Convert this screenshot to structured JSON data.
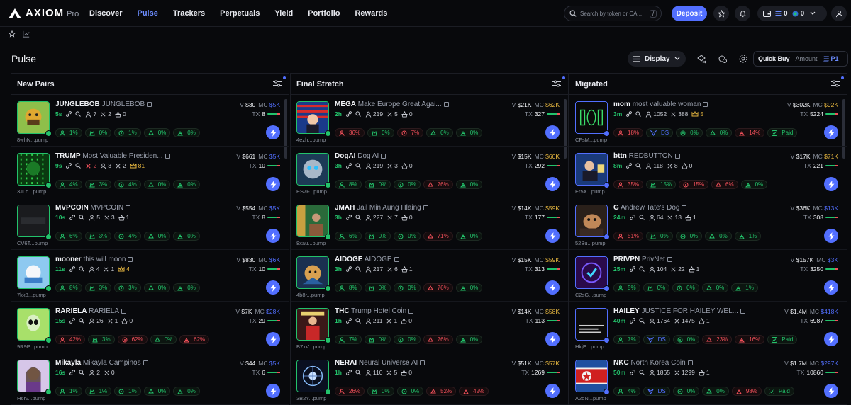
{
  "app": {
    "logo_text": "AXIOM",
    "logo_suffix": "Pro",
    "nav": [
      "Discover",
      "Pulse",
      "Trackers",
      "Perpetuals",
      "Yield",
      "Portfolio",
      "Rewards"
    ],
    "active_nav": "Pulse",
    "search_placeholder": "Search by token or CA...",
    "search_shortcut": "/",
    "deposit_label": "Deposit",
    "wallet_sol_balance": "0",
    "wallet_token_balance": "0",
    "accent": "#526fff",
    "positive": "#23c26b",
    "negative": "#f0505a",
    "gold": "#e8b840"
  },
  "page": {
    "title": "Pulse",
    "display_label": "Display",
    "quick_buy_label": "Quick Buy",
    "amount_placeholder": "Amount",
    "preset_label": "P1"
  },
  "columns": [
    {
      "title": "New Pairs",
      "rows": [
        {
          "symbol": "JUNGLEBOB",
          "name": "JUNGLEBOB",
          "addr": "8whN...pump",
          "age": "5s",
          "avatar": "pepe",
          "meta": [
            {
              "icon": "holders-icon",
              "v": "7"
            },
            {
              "icon": "pro-traders-icon",
              "v": "2"
            },
            {
              "icon": "kol-icon",
              "v": "0"
            }
          ],
          "v": "$30",
          "mc": "$5K",
          "mc_gold": false,
          "tx": "8",
          "pcts": [
            {
              "v": "1%",
              "red": false
            },
            {
              "v": "0%",
              "red": false
            },
            {
              "v": "1%",
              "red": false
            },
            {
              "v": "0%",
              "red": false
            },
            {
              "v": "0%",
              "red": false
            }
          ]
        },
        {
          "symbol": "TRUMP",
          "name": "Most Valuable Presiden...",
          "addr": "3JLd...pump",
          "age": "9s",
          "avatar": "matrix",
          "meta": [
            {
              "icon": "dev-sold-icon",
              "v": "2",
              "red": true
            },
            {
              "icon": "holders-icon",
              "v": "3"
            },
            {
              "icon": "pro-traders-icon",
              "v": "2"
            },
            {
              "icon": "crown-icon",
              "v": "81",
              "gold": true
            }
          ],
          "v": "$661",
          "mc": "$5K",
          "mc_gold": false,
          "tx": "10",
          "pcts": [
            {
              "v": "4%",
              "red": false
            },
            {
              "v": "3%",
              "red": false
            },
            {
              "v": "4%",
              "red": false
            },
            {
              "v": "0%",
              "red": false
            },
            {
              "v": "0%",
              "red": false
            }
          ]
        },
        {
          "symbol": "MVPCOIN",
          "name": "MVPCOIN",
          "addr": "CV6T...pump",
          "age": "10s",
          "avatar": "dark",
          "meta": [
            {
              "icon": "holders-icon",
              "v": "5"
            },
            {
              "icon": "pro-traders-icon",
              "v": "3"
            },
            {
              "icon": "kol-icon",
              "v": "1"
            }
          ],
          "v": "$554",
          "mc": "$5K",
          "mc_gold": false,
          "tx": "8",
          "pcts": [
            {
              "v": "6%",
              "red": false
            },
            {
              "v": "3%",
              "red": false
            },
            {
              "v": "4%",
              "red": false
            },
            {
              "v": "0%",
              "red": false
            },
            {
              "v": "0%",
              "red": false
            }
          ]
        },
        {
          "symbol": "mooner",
          "name": "this will moon",
          "addr": "7kk8...pump",
          "age": "11s",
          "avatar": "sky",
          "meta": [
            {
              "icon": "holders-icon",
              "v": "4"
            },
            {
              "icon": "pro-traders-icon",
              "v": "1"
            },
            {
              "icon": "crown-icon",
              "v": "4",
              "gold": true
            }
          ],
          "v": "$830",
          "mc": "$6K",
          "mc_gold": false,
          "tx": "10",
          "pcts": [
            {
              "v": "8%",
              "red": false
            },
            {
              "v": "3%",
              "red": false
            },
            {
              "v": "3%",
              "red": false
            },
            {
              "v": "0%",
              "red": false
            },
            {
              "v": "0%",
              "red": false
            }
          ]
        },
        {
          "symbol": "RARIELA",
          "name": "RARIELA",
          "addr": "9R9P...pump",
          "age": "15s",
          "avatar": "alien",
          "meta": [
            {
              "icon": "holders-icon",
              "v": "26"
            },
            {
              "icon": "pro-traders-icon",
              "v": "1"
            },
            {
              "icon": "kol-icon",
              "v": "0"
            }
          ],
          "v": "$7K",
          "mc": "$28K",
          "mc_gold": false,
          "tx": "29",
          "pcts": [
            {
              "v": "42%",
              "red": true
            },
            {
              "v": "3%",
              "red": false
            },
            {
              "v": "62%",
              "red": true
            },
            {
              "v": "0%",
              "red": false
            },
            {
              "v": "62%",
              "red": true
            }
          ]
        },
        {
          "symbol": "Mikayla",
          "name": "Mikayla Campinos",
          "addr": "H6rv...pump",
          "age": "16s",
          "avatar": "girl",
          "meta": [
            {
              "icon": "holders-icon",
              "v": "2"
            },
            {
              "icon": "pro-traders-icon",
              "v": "0"
            }
          ],
          "v": "$44",
          "mc": "$5K",
          "mc_gold": false,
          "tx": "6",
          "pcts": [
            {
              "v": "1%",
              "red": false
            },
            {
              "v": "1%",
              "red": false
            },
            {
              "v": "1%",
              "red": false
            },
            {
              "v": "0%",
              "red": false
            },
            {
              "v": "0%",
              "red": false
            }
          ]
        }
      ]
    },
    {
      "title": "Final Stretch",
      "rows": [
        {
          "symbol": "MEGA",
          "name": "Make Europe Great Agai...",
          "addr": "4ezh...pump",
          "age": "2h",
          "avatar": "flag",
          "meta": [
            {
              "icon": "holders-icon",
              "v": "219"
            },
            {
              "icon": "pro-traders-icon",
              "v": "5"
            },
            {
              "icon": "kol-icon",
              "v": "0"
            }
          ],
          "v": "$21K",
          "mc": "$62K",
          "mc_gold": true,
          "tx": "327",
          "pcts": [
            {
              "v": "36%",
              "red": true
            },
            {
              "v": "0%",
              "red": false
            },
            {
              "v": "7%",
              "red": true
            },
            {
              "v": "0%",
              "red": false
            },
            {
              "v": "0%",
              "red": false
            }
          ]
        },
        {
          "symbol": "DogAI",
          "name": "Dog AI",
          "addr": "ES7F...pump",
          "age": "3h",
          "avatar": "robot",
          "meta": [
            {
              "icon": "holders-icon",
              "v": "219"
            },
            {
              "icon": "pro-traders-icon",
              "v": "3"
            },
            {
              "icon": "kol-icon",
              "v": "0"
            }
          ],
          "v": "$15K",
          "mc": "$60K",
          "mc_gold": true,
          "tx": "292",
          "pcts": [
            {
              "v": "8%",
              "red": false
            },
            {
              "v": "0%",
              "red": false
            },
            {
              "v": "0%",
              "red": false
            },
            {
              "v": "76%",
              "red": true
            },
            {
              "v": "0%",
              "red": false
            }
          ]
        },
        {
          "symbol": "JMAH",
          "name": "Jail Min Aung Hlaing",
          "addr": "8xau...pump",
          "age": "3h",
          "avatar": "podium",
          "meta": [
            {
              "icon": "holders-icon",
              "v": "227"
            },
            {
              "icon": "pro-traders-icon",
              "v": "7"
            },
            {
              "icon": "kol-icon",
              "v": "0"
            }
          ],
          "v": "$14K",
          "mc": "$59K",
          "mc_gold": true,
          "tx": "177",
          "pcts": [
            {
              "v": "6%",
              "red": false
            },
            {
              "v": "0%",
              "red": false
            },
            {
              "v": "0%",
              "red": false
            },
            {
              "v": "71%",
              "red": true
            },
            {
              "v": "0%",
              "red": false
            }
          ]
        },
        {
          "symbol": "AIDOGE",
          "name": "AIDOGE",
          "addr": "4b8r...pump",
          "age": "3h",
          "avatar": "doge",
          "meta": [
            {
              "icon": "holders-icon",
              "v": "217"
            },
            {
              "icon": "pro-traders-icon",
              "v": "6"
            },
            {
              "icon": "kol-icon",
              "v": "1"
            }
          ],
          "v": "$15K",
          "mc": "$59K",
          "mc_gold": true,
          "tx": "313",
          "pcts": [
            {
              "v": "8%",
              "red": false
            },
            {
              "v": "0%",
              "red": false
            },
            {
              "v": "0%",
              "red": false
            },
            {
              "v": "76%",
              "red": true
            },
            {
              "v": "0%",
              "red": false
            }
          ]
        },
        {
          "symbol": "THC",
          "name": "Trump Hotel Coin",
          "addr": "B7xV...pump",
          "age": "1h",
          "avatar": "suit",
          "meta": [
            {
              "icon": "holders-icon",
              "v": "211"
            },
            {
              "icon": "pro-traders-icon",
              "v": "1"
            },
            {
              "icon": "kol-icon",
              "v": "0"
            }
          ],
          "v": "$14K",
          "mc": "$58K",
          "mc_gold": true,
          "tx": "113",
          "pcts": [
            {
              "v": "7%",
              "red": false
            },
            {
              "v": "0%",
              "red": false
            },
            {
              "v": "0%",
              "red": false
            },
            {
              "v": "76%",
              "red": true
            },
            {
              "v": "0%",
              "red": false
            }
          ]
        },
        {
          "symbol": "NERAI",
          "name": "Neural Universe AI",
          "addr": "3B2Y...pump",
          "age": "1h",
          "avatar": "neural",
          "meta": [
            {
              "icon": "holders-icon",
              "v": "110"
            },
            {
              "icon": "pro-traders-icon",
              "v": "5"
            },
            {
              "icon": "kol-icon",
              "v": "0"
            }
          ],
          "v": "$51K",
          "mc": "$57K",
          "mc_gold": true,
          "tx": "1269",
          "pcts": [
            {
              "v": "26%",
              "red": true
            },
            {
              "v": "0%",
              "red": false
            },
            {
              "v": "0%",
              "red": false
            },
            {
              "v": "52%",
              "red": true
            },
            {
              "v": "42%",
              "red": true
            }
          ]
        }
      ]
    },
    {
      "title": "Migrated",
      "rows": [
        {
          "symbol": "mom",
          "name": "most valuable woman",
          "addr": "CFsM...pump",
          "age": "3m",
          "avatar": "ioi",
          "meta": [
            {
              "icon": "holders-icon",
              "v": "1052"
            },
            {
              "icon": "pro-traders-icon",
              "v": "388"
            },
            {
              "icon": "crown-icon",
              "v": "5",
              "gold": true
            }
          ],
          "v": "$302K",
          "mc": "$92K",
          "mc_gold": true,
          "tx": "5224",
          "pcts": [
            {
              "v": "18%",
              "red": true
            },
            {
              "v": "DS",
              "red": false,
              "ds": true
            },
            {
              "v": "0%",
              "red": false
            },
            {
              "v": "0%",
              "red": false
            },
            {
              "v": "14%",
              "red": true
            }
          ],
          "paid": "Paid"
        },
        {
          "symbol": "bttn",
          "name": "REDBUTTON",
          "addr": "Er5X...pump",
          "age": "8m",
          "avatar": "news",
          "meta": [
            {
              "icon": "holders-icon",
              "v": "118"
            },
            {
              "icon": "pro-traders-icon",
              "v": "8"
            },
            {
              "icon": "kol-icon",
              "v": "0"
            }
          ],
          "v": "$17K",
          "mc": "$71K",
          "mc_gold": true,
          "tx": "221",
          "pcts": [
            {
              "v": "35%",
              "red": true
            },
            {
              "v": "15%",
              "red": false
            },
            {
              "v": "15%",
              "red": true
            },
            {
              "v": "6%",
              "red": true
            },
            {
              "v": "0%",
              "red": false
            }
          ]
        },
        {
          "symbol": "G",
          "name": "Andrew Tate's Dog",
          "addr": "52Bu...pump",
          "age": "24m",
          "avatar": "dog",
          "meta": [
            {
              "icon": "holders-icon",
              "v": "64"
            },
            {
              "icon": "pro-traders-icon",
              "v": "13"
            },
            {
              "icon": "kol-icon",
              "v": "1"
            }
          ],
          "v": "$36K",
          "mc": "$13K",
          "mc_gold": false,
          "tx": "308",
          "pcts": [
            {
              "v": "51%",
              "red": true
            },
            {
              "v": "0%",
              "red": false
            },
            {
              "v": "0%",
              "red": false
            },
            {
              "v": "0%",
              "red": false
            },
            {
              "v": "1%",
              "red": false
            }
          ]
        },
        {
          "symbol": "PRIVPN",
          "name": "PrivNet",
          "addr": "C2sG...pump",
          "age": "25m",
          "avatar": "vpn",
          "meta": [
            {
              "icon": "holders-icon",
              "v": "104"
            },
            {
              "icon": "pro-traders-icon",
              "v": "22"
            },
            {
              "icon": "kol-icon",
              "v": "1"
            }
          ],
          "v": "$157K",
          "mc": "$3K",
          "mc_gold": false,
          "tx": "3250",
          "pcts": [
            {
              "v": "5%",
              "red": false
            },
            {
              "v": "0%",
              "red": false
            },
            {
              "v": "0%",
              "red": false
            },
            {
              "v": "0%",
              "red": false
            },
            {
              "v": "1%",
              "red": false
            }
          ]
        },
        {
          "symbol": "HAILEY",
          "name": "JUSTICE FOR HAILEY WEL...",
          "addr": "HkjE...pump",
          "age": "40m",
          "avatar": "tweet",
          "meta": [
            {
              "icon": "holders-icon",
              "v": "1764"
            },
            {
              "icon": "pro-traders-icon",
              "v": "1475"
            },
            {
              "icon": "kol-icon",
              "v": "1"
            }
          ],
          "v": "$1.4M",
          "mc": "$418K",
          "mc_gold": false,
          "tx": "6987",
          "pcts": [
            {
              "v": "7%",
              "red": false
            },
            {
              "v": "DS",
              "red": false,
              "ds": true
            },
            {
              "v": "0%",
              "red": false
            },
            {
              "v": "23%",
              "red": true
            },
            {
              "v": "16%",
              "red": true
            }
          ],
          "paid": "Paid"
        },
        {
          "symbol": "NKC",
          "name": "North Korea Coin",
          "addr": "A2oN...pump",
          "age": "50m",
          "avatar": "nk",
          "meta": [
            {
              "icon": "holders-icon",
              "v": "1865"
            },
            {
              "icon": "pro-traders-icon",
              "v": "1299"
            },
            {
              "icon": "kol-icon",
              "v": "1"
            }
          ],
          "v": "$1.7M",
          "mc": "$297K",
          "mc_gold": false,
          "tx": "10860",
          "pcts": [
            {
              "v": "4%",
              "red": false
            },
            {
              "v": "DS",
              "red": false,
              "ds": true
            },
            {
              "v": "0%",
              "red": false
            },
            {
              "v": "0%",
              "red": false
            },
            {
              "v": "98%",
              "red": true
            }
          ],
          "paid": "Paid"
        }
      ]
    }
  ]
}
